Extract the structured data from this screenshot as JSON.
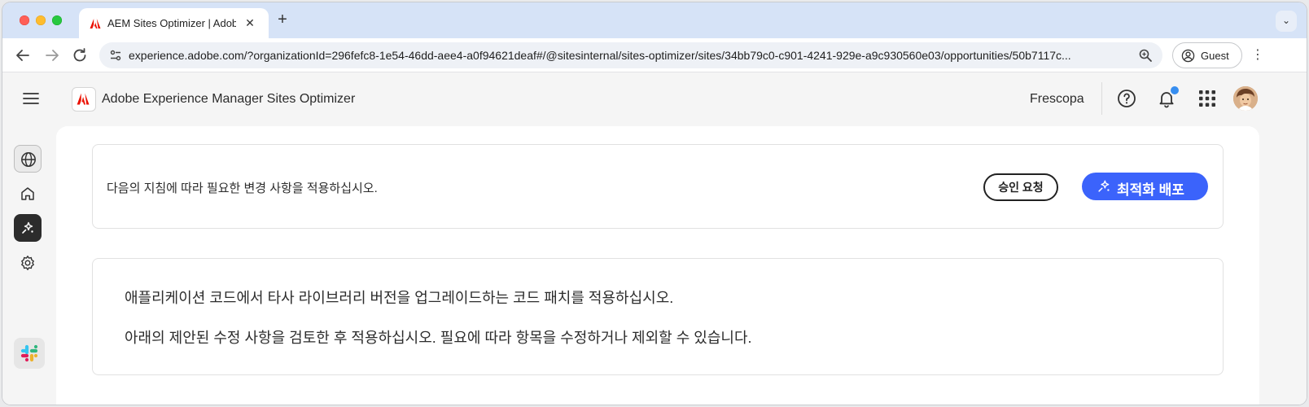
{
  "browser": {
    "tab_title": "AEM Sites Optimizer | Adobe",
    "url": "experience.adobe.com/?organizationId=296fefc8-1e54-46dd-aee4-a0f94621deaf#/@sitesinternal/sites-optimizer/sites/34bb79c0-c901-4241-929e-a9c930560e03/opportunities/50b7117c...",
    "profile_label": "Guest",
    "colors": {
      "tabstrip": "#d6e3f7",
      "omnibox": "#eef1f6"
    }
  },
  "header": {
    "app_name": "Adobe Experience Manager Sites Optimizer",
    "org_name": "Frescopa",
    "icons": [
      "hamburger-icon",
      "adobe-logo",
      "help-icon",
      "bell-icon",
      "apps-grid-icon",
      "avatar"
    ],
    "has_notification": true
  },
  "rail": {
    "items": [
      {
        "name": "globe-icon",
        "state": "selected"
      },
      {
        "name": "home-icon",
        "state": "default"
      },
      {
        "name": "optimize-icon",
        "state": "active"
      },
      {
        "name": "settings-icon",
        "state": "default"
      },
      {
        "name": "slack-icon",
        "state": "default"
      }
    ]
  },
  "action_card": {
    "instruction": "다음의 지침에 따라 필요한 변경 사항을 적용하십시오.",
    "request_approval_label": "승인 요청",
    "deploy_label": "최적화 배포"
  },
  "description_card": {
    "line1": "애플리케이션 코드에서 타사 라이브러리 버전을 업그레이드하는 코드 패치를 적용하십시오.",
    "line2": "아래의 제안된 수정 사항을 검토한 후 적용하십시오. 필요에 따라 항목을 수정하거나 제외할 수 있습니다."
  },
  "colors": {
    "accent": "#3b63fb",
    "adobe_red": "#eb1000",
    "notification": "#378ef0"
  }
}
